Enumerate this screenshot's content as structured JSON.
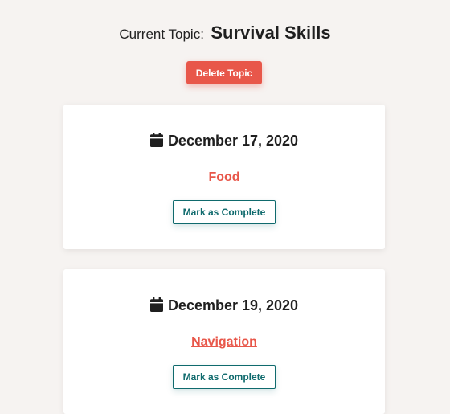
{
  "header": {
    "label": "Current Topic:",
    "topic": "Survival Skills"
  },
  "actions": {
    "delete_label": "Delete Topic"
  },
  "cards": [
    {
      "date": "December 17, 2020",
      "link": "Food",
      "button": "Mark as Complete"
    },
    {
      "date": "December 19, 2020",
      "link": "Navigation",
      "button": "Mark as Complete"
    }
  ],
  "colors": {
    "background": "#f6f3f1",
    "accent": "#e8574a",
    "teal": "#0f6a6d"
  },
  "icons": {
    "date": "calendar-icon"
  }
}
